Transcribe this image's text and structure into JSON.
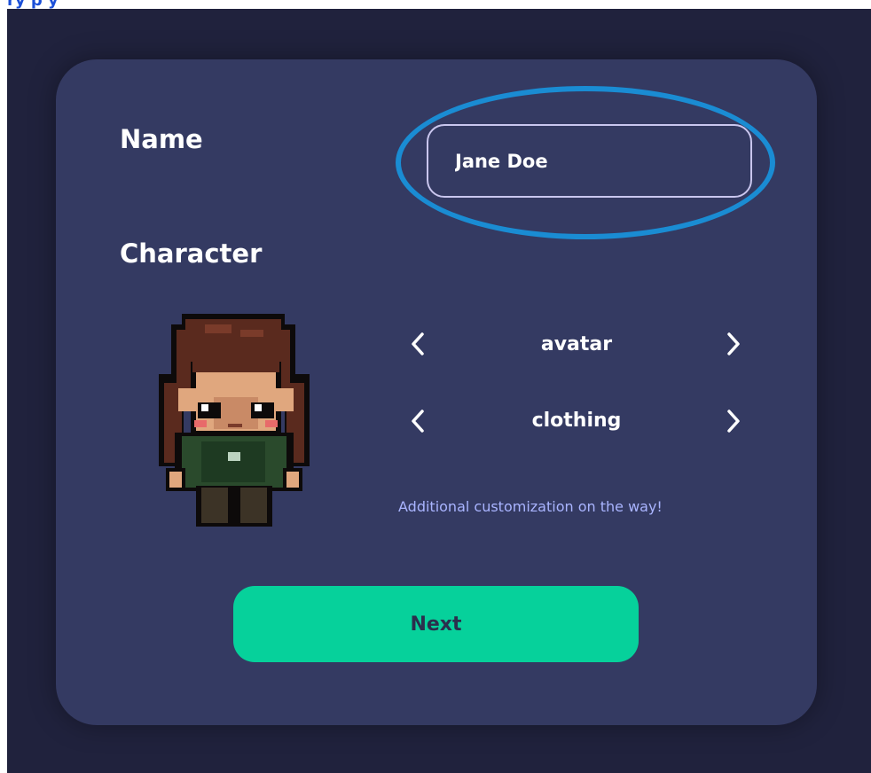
{
  "form": {
    "name_label": "Name",
    "name_value": "Jane Doe",
    "character_label": "Character",
    "avatar_option": "avatar",
    "clothing_option": "clothing",
    "customization_note": "Additional customization on the way!",
    "next_label": "Next"
  },
  "icons": {
    "prev": "chevron-left-icon",
    "next": "chevron-right-icon"
  },
  "colors": {
    "background": "#20223d",
    "card": "#343a62",
    "accent_button": "#06d19b",
    "highlight_ring": "#1a8cd3",
    "note_text": "#a9b4ff"
  }
}
